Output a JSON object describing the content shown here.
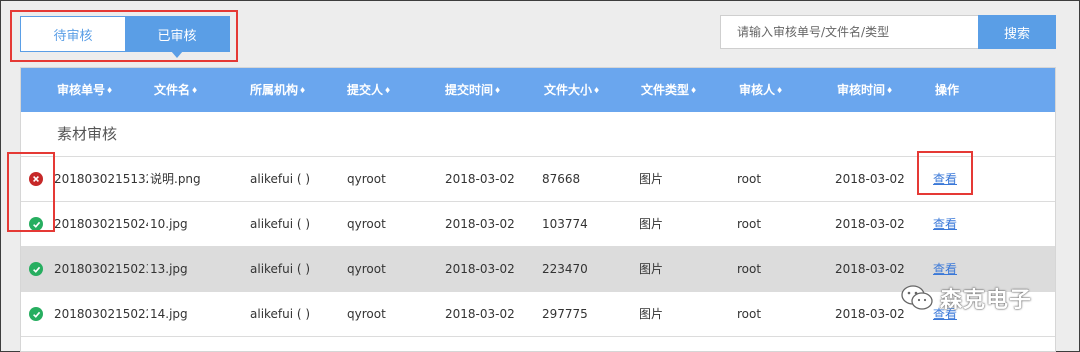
{
  "tabs": [
    {
      "label": "待审核",
      "active": false
    },
    {
      "label": "已审核",
      "active": true
    }
  ],
  "search": {
    "placeholder": "请输入审核单号/文件名/类型",
    "button_label": "搜索"
  },
  "table": {
    "sort_glyph": "♦",
    "columns": [
      "审核单号",
      "文件名",
      "所属机构",
      "提交人",
      "提交时间",
      "文件大小",
      "文件类型",
      "审核人",
      "审核时间",
      "操作"
    ],
    "group_title": "素材审核",
    "action_label": "查看",
    "rows": [
      {
        "status": "rejected",
        "id": "2018030215132...",
        "file": "说明.png",
        "org": "alikefui ( )",
        "submitter": "qyroot",
        "submit_time": "2018-03-02",
        "size": "87668",
        "type": "图片",
        "reviewer": "root",
        "review_time": "2018-03-02"
      },
      {
        "status": "approved",
        "id": "2018030215024...",
        "file": "10.jpg",
        "org": "alikefui ( )",
        "submitter": "qyroot",
        "submit_time": "2018-03-02",
        "size": "103774",
        "type": "图片",
        "reviewer": "root",
        "review_time": "2018-03-02"
      },
      {
        "status": "approved",
        "id": "2018030215023...",
        "file": "13.jpg",
        "org": "alikefui ( )",
        "submitter": "qyroot",
        "submit_time": "2018-03-02",
        "size": "223470",
        "type": "图片",
        "reviewer": "root",
        "review_time": "2018-03-02"
      },
      {
        "status": "approved",
        "id": "2018030215022...",
        "file": "14.jpg",
        "org": "alikefui ( )",
        "submitter": "qyroot",
        "submit_time": "2018-03-02",
        "size": "297775",
        "type": "图片",
        "reviewer": "root",
        "review_time": "2018-03-02"
      }
    ]
  },
  "watermark": {
    "text": "森克电子",
    "icon": "wechat-icon"
  },
  "colors": {
    "accent": "#5a9ee6",
    "header": "#6aa6ee",
    "ok": "#27ae60",
    "error": "#c62828",
    "highlight": "#e53935"
  }
}
